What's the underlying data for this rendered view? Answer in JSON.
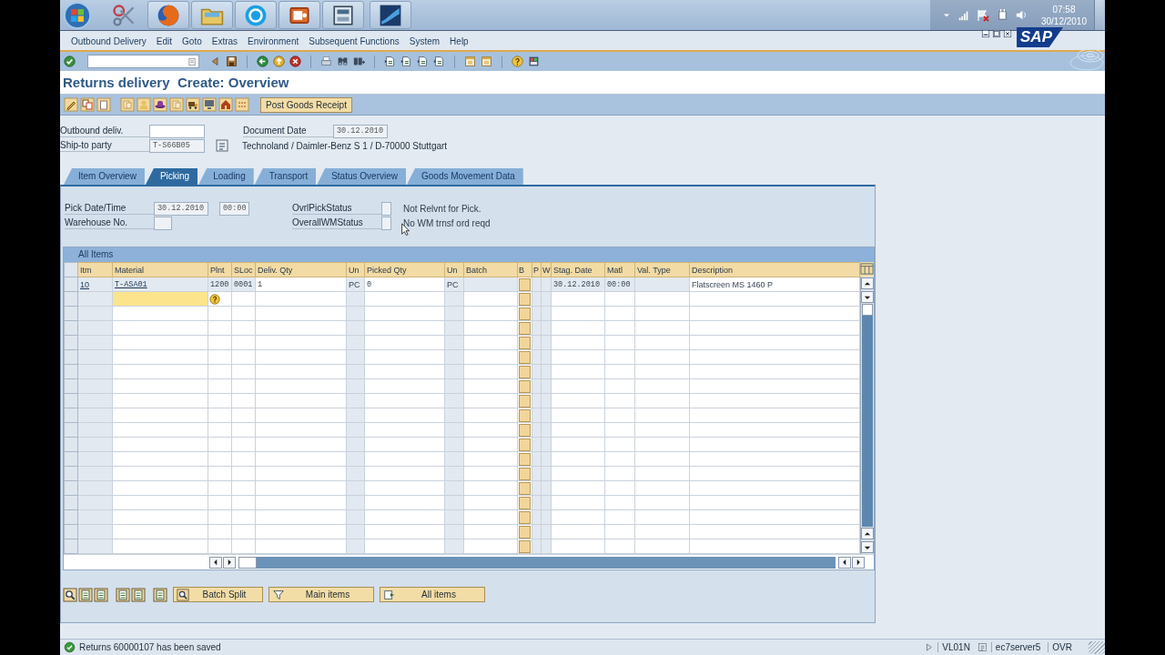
{
  "taskbar": {
    "clock": {
      "time": "07:58",
      "date": "30/12/2010"
    }
  },
  "menu": [
    "Outbound Delivery",
    "Edit",
    "Goto",
    "Extras",
    "Environment",
    "Subsequent Functions",
    "System",
    "Help"
  ],
  "logo": "SAP",
  "title": "Returns delivery  Create: Overview",
  "app_toolbar": {
    "buttons": [
      "Post Goods Receipt"
    ]
  },
  "header": {
    "outbound_deliv": {
      "label": "Outbound deliv."
    },
    "document_date": {
      "label": "Document Date",
      "value": "30.12.2010"
    },
    "ship_to_party": {
      "label": "Ship-to party",
      "value": "T-S66B05",
      "description": "Technoland / Daimler-Benz S 1 / D-70000 Stuttgart"
    }
  },
  "tabs": [
    {
      "label": "Item Overview",
      "selected": false
    },
    {
      "label": "Picking",
      "selected": true
    },
    {
      "label": "Loading",
      "selected": false
    },
    {
      "label": "Transport",
      "selected": false
    },
    {
      "label": "Status Overview",
      "selected": false
    },
    {
      "label": "Goods Movement Data",
      "selected": false
    }
  ],
  "picking": {
    "pick_date_time": {
      "label": "Pick Date/Time",
      "date": "30.12.2010",
      "time": "00:00"
    },
    "warehouse_no": {
      "label": "Warehouse No."
    },
    "ovrl_pick_status": {
      "label": "OvrlPickStatus",
      "status_text": "Not Relvnt for Pick."
    },
    "overall_wm_status": {
      "label": "OverallWMStatus",
      "status_text": "No WM trnsf ord reqd"
    }
  },
  "items_table": {
    "title": "All Items",
    "columns": [
      "Itm",
      "Material",
      "Plnt",
      "SLoc",
      "Deliv. Qty",
      "Un",
      "Picked Qty",
      "Un",
      "Batch",
      "B",
      "P",
      "W",
      "Stag. Date",
      "Matl",
      "Val. Type",
      "Description"
    ],
    "rows": [
      {
        "item": "10",
        "material": "T-ASA01",
        "plant": "1200",
        "storage_location": "0001",
        "deliv_qty": "1",
        "deliv_unit": "PC",
        "picked_qty": "0",
        "picked_unit": "PC",
        "staging_date": "30.12.2010",
        "matl_avail_time": "00:00",
        "description": "Flatscreen MS 1460 P"
      }
    ],
    "new_entry": {
      "focused": true
    }
  },
  "bottom_buttons": [
    "Batch Split",
    "Main items",
    "All items"
  ],
  "status_bar": {
    "message": "Returns 60000107 has been saved",
    "transaction": "VL01N",
    "server": "ec7server5",
    "mode": "OVR"
  }
}
